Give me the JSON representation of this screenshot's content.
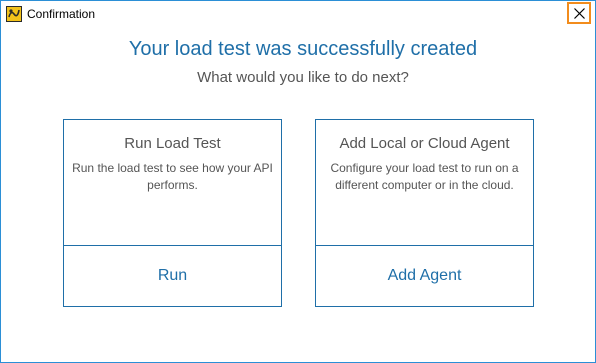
{
  "window": {
    "title": "Confirmation",
    "app_icon": "loadui-app-icon",
    "close_icon": "close-icon"
  },
  "main": {
    "headline": "Your load test was successfully created",
    "subheadline": "What would you like to do next?"
  },
  "cards": [
    {
      "title": "Run Load Test",
      "description": "Run the load test to see how your API performs.",
      "action_label": "Run"
    },
    {
      "title": "Add Local or Cloud Agent",
      "description": "Configure your load test to run on a different computer or in the cloud.",
      "action_label": "Add Agent"
    }
  ],
  "colors": {
    "accent": "#1f6fa8",
    "close_highlight": "#f28c1c",
    "text_muted": "#555555"
  }
}
